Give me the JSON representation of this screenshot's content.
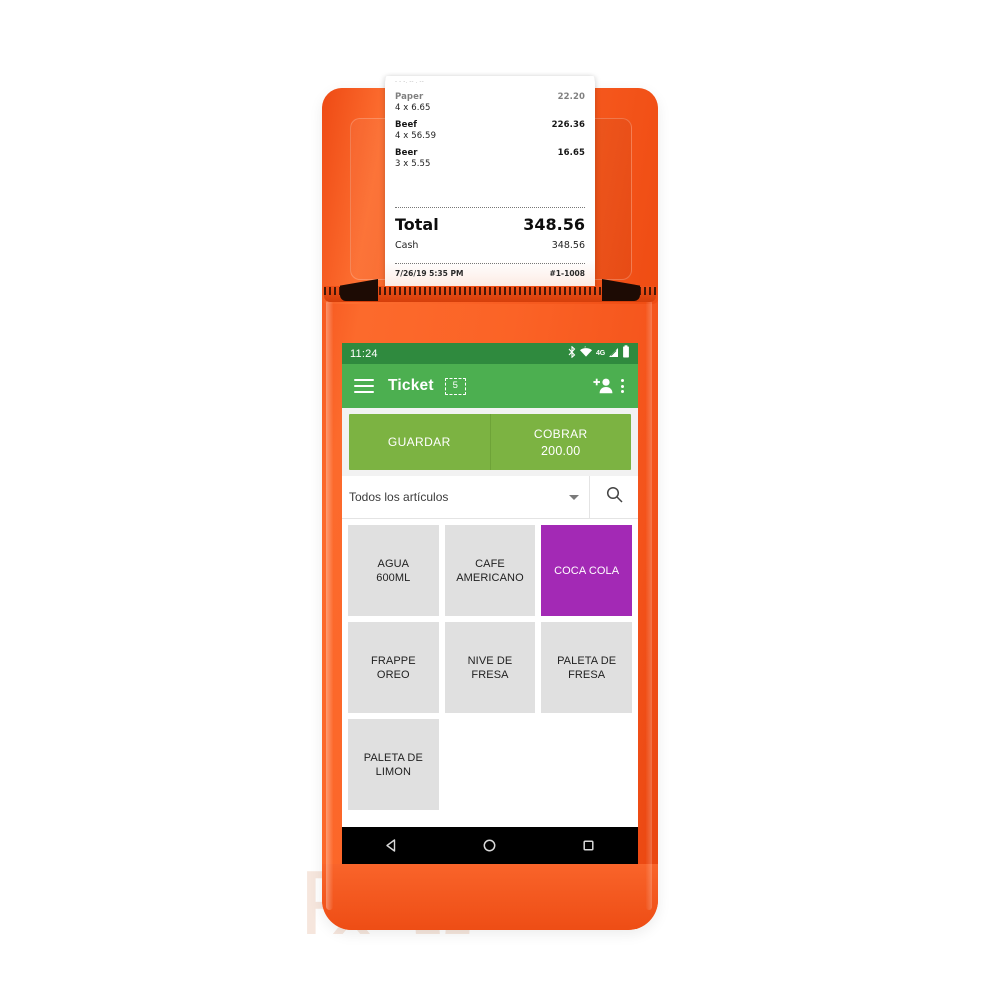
{
  "device": {
    "name": "pos-terminal",
    "body_color": "#f9602a",
    "accent_color": "#ee4a14"
  },
  "receipt": {
    "cut_marks": "''''''''''''''''''''''''''''''''''''''''''''''''''''''''",
    "faint_top_line": "- - -. -- . --",
    "items": [
      {
        "name": "Paper",
        "qty_line": "4 x 6.65",
        "amount": "22.20"
      },
      {
        "name": "Beef",
        "qty_line": "4 x 56.59",
        "amount": "226.36"
      },
      {
        "name": "Beer",
        "qty_line": "3 x 5.55",
        "amount": "16.65"
      }
    ],
    "total_label": "Total",
    "total_value": "348.56",
    "payment_label": "Cash",
    "payment_value": "348.56",
    "timestamp": "7/26/19 5:35 PM",
    "receipt_number": "#1-1008"
  },
  "screen": {
    "statusbar": {
      "time": "11:24",
      "icons": [
        "bluetooth-icon",
        "wifi-icon",
        "4g-label",
        "signal-icon",
        "battery-icon"
      ],
      "network_label": "4G",
      "background": "#2f8a3e"
    },
    "appbar": {
      "menu_icon": "hamburger-icon",
      "title": "Ticket",
      "badge_count": "5",
      "add_customer_icon": "add-person-icon",
      "overflow_icon": "kebab-menu-icon",
      "background": "#4caf50"
    },
    "actions": {
      "save_label": "GUARDAR",
      "charge_label": "COBRAR",
      "charge_amount": "200.00",
      "button_color": "#7cb342"
    },
    "filter": {
      "selected_category": "Todos los artículos",
      "dropdown_icon": "chevron-down-icon",
      "search_icon": "search-icon"
    },
    "products": [
      {
        "label": "AGUA\n600ML",
        "line1": "AGUA",
        "line2": "600ML",
        "highlighted": false
      },
      {
        "label": "CAFE AMERICANO",
        "line1": "CAFE",
        "line2": "AMERICANO",
        "highlighted": false
      },
      {
        "label": "COCA COLA",
        "line1": "COCA COLA",
        "line2": "",
        "highlighted": true
      },
      {
        "label": "FRAPPE OREO",
        "line1": "FRAPPE",
        "line2": "OREO",
        "highlighted": false
      },
      {
        "label": "NIVE DE FRESA",
        "line1": "NIVE DE",
        "line2": "FRESA",
        "highlighted": false
      },
      {
        "label": "PALETA DE FRESA",
        "line1": "PALETA DE",
        "line2": "FRESA",
        "highlighted": false
      },
      {
        "label": "PALETA DE LIMON",
        "line1": "PALETA DE",
        "line2": "LIMON",
        "highlighted": false
      }
    ],
    "highlight_color": "#a329b5",
    "tile_color": "#e0e0e0",
    "navbar": {
      "back_icon": "back-triangle-icon",
      "home_icon": "home-circle-icon",
      "recents_icon": "recents-square-icon"
    }
  },
  "watermark": {
    "text": "℞ Ω"
  }
}
